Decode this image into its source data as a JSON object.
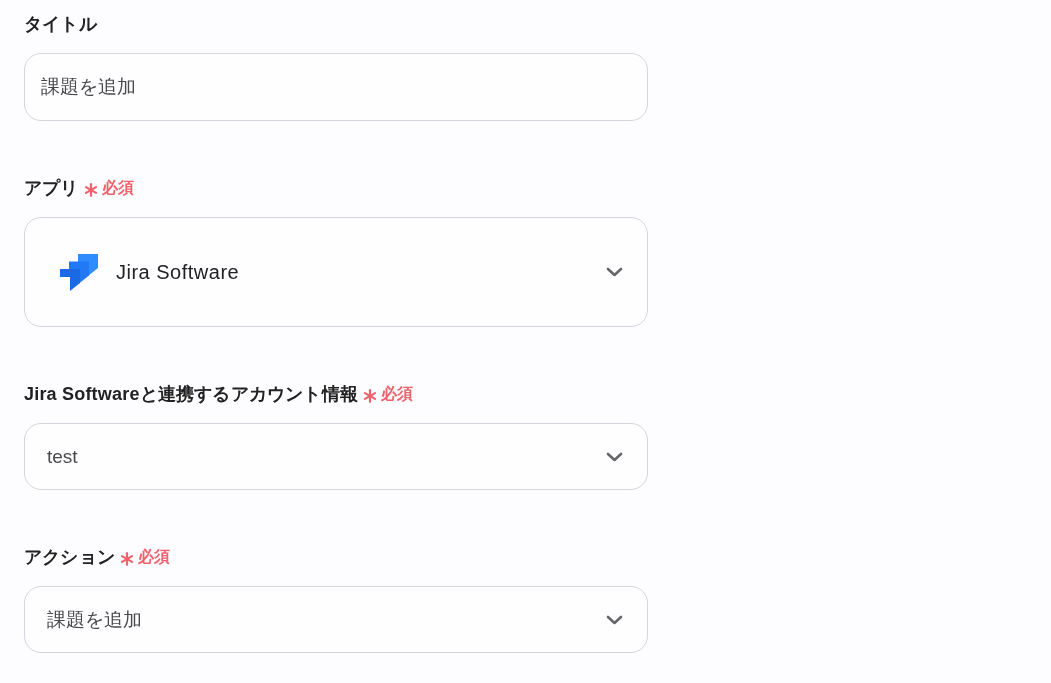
{
  "fields": [
    {
      "kind": "text",
      "label": "タイトル",
      "required": false,
      "value": "課題を追加"
    },
    {
      "kind": "app_select",
      "label": "アプリ",
      "required": true,
      "required_text": "必須",
      "value": "Jira Software"
    },
    {
      "kind": "select",
      "label": "Jira Softwareと連携するアカウント情報",
      "required": true,
      "required_text": "必須",
      "value": "test"
    },
    {
      "kind": "select",
      "label": "アクション",
      "required": true,
      "required_text": "必須",
      "value": "課題を追加"
    }
  ]
}
